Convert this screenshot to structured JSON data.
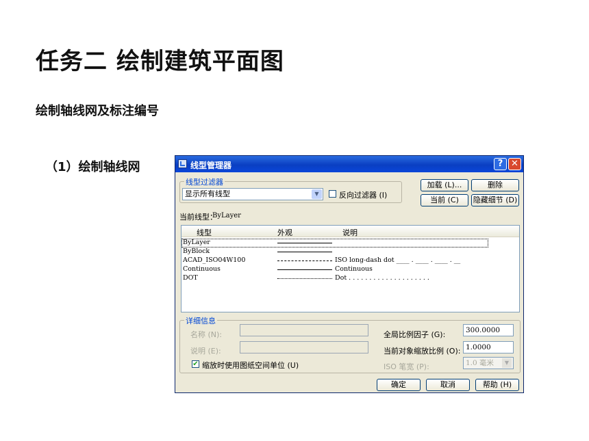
{
  "slide": {
    "title": "任务二  绘制建筑平面图",
    "subtitle": "绘制轴线网及标注编号",
    "step": "（1）绘制轴线网"
  },
  "dialog": {
    "title": "线型管理器",
    "help_btn": "?",
    "close_btn": "✕",
    "filter_group": "线型过滤器",
    "filter_value": "显示所有线型",
    "invert_filter": "反向过滤器 (I)",
    "btn_load": "加载 (L)...",
    "btn_delete": "删除",
    "btn_current": "当前 (C)",
    "btn_hide_details": "隐藏细节 (D)",
    "current_linetype_label": "当前线型：",
    "current_linetype_value": "ByLayer",
    "columns": {
      "linetype": "线型",
      "appearance": "外观",
      "description": "说明"
    },
    "rows": [
      {
        "name": "ByLayer",
        "desc": ""
      },
      {
        "name": "ByBlock",
        "desc": ""
      },
      {
        "name": "ACAD_ISO04W100",
        "desc": "ISO long-dash dot ____ . ____ . ____ . __"
      },
      {
        "name": "Continuous",
        "desc": "Continuous"
      },
      {
        "name": "DOT",
        "desc": "Dot . . . . . . . . . . . . . . . . . . . ."
      }
    ],
    "details_group": "详细信息",
    "name_label": "名称 (N):",
    "desc_label": "说明 (E):",
    "scale_paper_units": "缩放时使用图纸空间单位 (U)",
    "global_scale_label": "全局比例因子 (G):",
    "global_scale_value": "300.0000",
    "object_scale_label": "当前对象缩放比例 (O):",
    "object_scale_value": "1.0000",
    "iso_pen_label": "ISO 笔宽 (P):",
    "iso_pen_value": "1.0 毫米",
    "btn_ok": "确定",
    "btn_cancel": "取消",
    "btn_help": "帮助 (H)"
  }
}
